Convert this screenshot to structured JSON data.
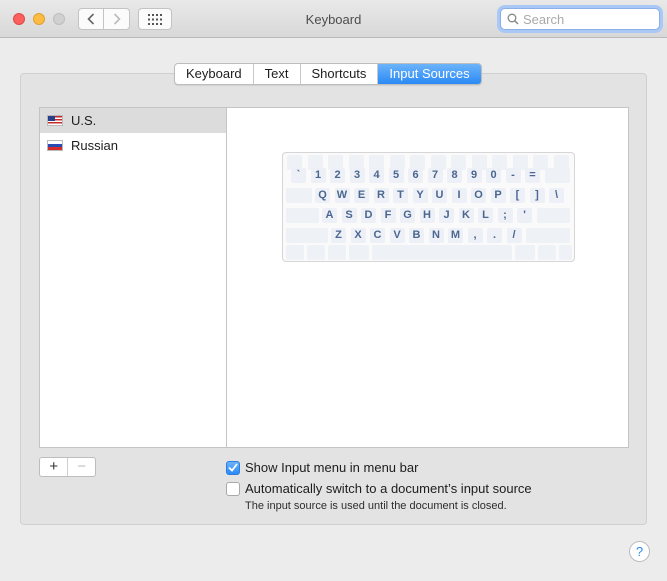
{
  "window": {
    "title": "Keyboard"
  },
  "search": {
    "placeholder": "Search"
  },
  "tabs": [
    {
      "label": "Keyboard",
      "active": false
    },
    {
      "label": "Text",
      "active": false
    },
    {
      "label": "Shortcuts",
      "active": false
    },
    {
      "label": "Input Sources",
      "active": true
    }
  ],
  "input_sources": [
    {
      "label": "U.S.",
      "flag": "us-flag",
      "selected": true
    },
    {
      "label": "Russian",
      "flag": "ru-flag",
      "selected": false
    }
  ],
  "keyboard_rows": [
    [
      "`",
      "1",
      "2",
      "3",
      "4",
      "5",
      "6",
      "7",
      "8",
      "9",
      "0",
      "-",
      "="
    ],
    [
      "Q",
      "W",
      "E",
      "R",
      "T",
      "Y",
      "U",
      "I",
      "O",
      "P",
      "[",
      "]",
      "\\"
    ],
    [
      "A",
      "S",
      "D",
      "F",
      "G",
      "H",
      "J",
      "K",
      "L",
      ";",
      "'"
    ],
    [
      "Z",
      "X",
      "C",
      "V",
      "B",
      "N",
      "M",
      ",",
      ".",
      "/"
    ]
  ],
  "buttons": {
    "add": "+",
    "remove": "−",
    "help": "?"
  },
  "options": {
    "show_input_menu": {
      "label": "Show Input menu in menu bar",
      "checked": true
    },
    "auto_switch": {
      "label": "Automatically switch to a document’s input source",
      "checked": false
    },
    "note": "The input source is used until the document is closed."
  },
  "colors": {
    "accent": "#2a8af5",
    "key_text": "#4b6690"
  }
}
